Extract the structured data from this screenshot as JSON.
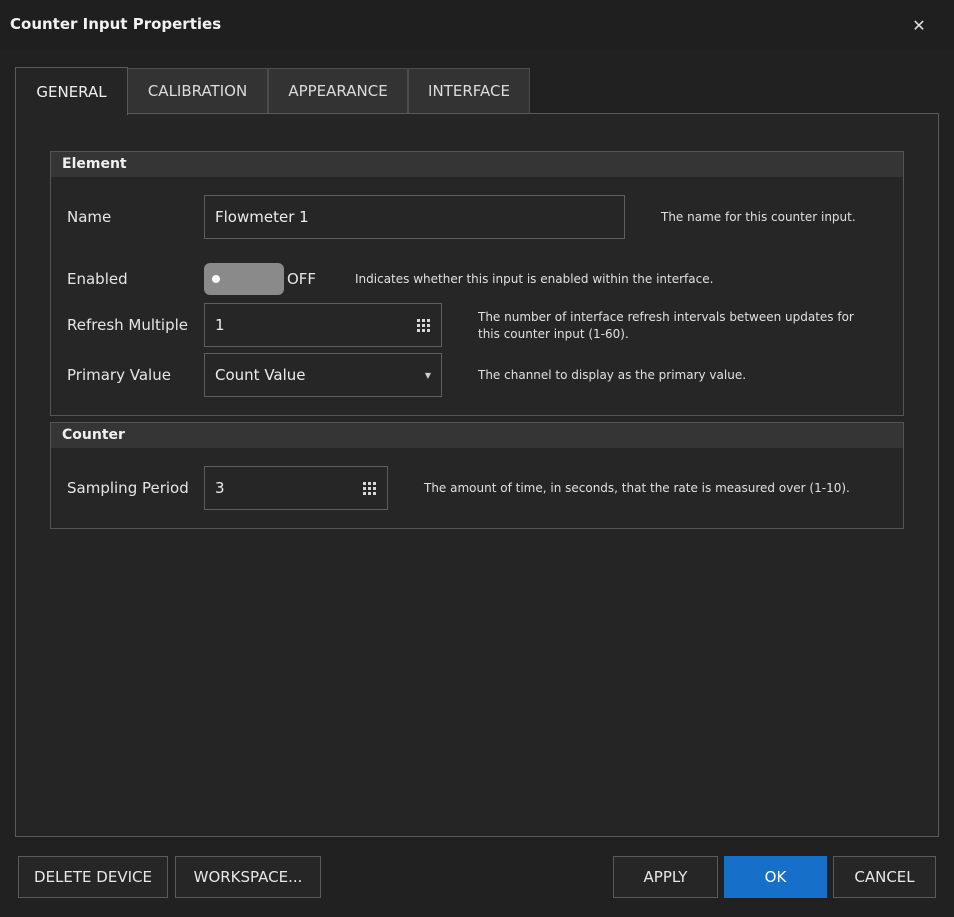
{
  "window": {
    "title": "Counter Input Properties",
    "close_glyph": "✕"
  },
  "tabs": [
    {
      "label": "GENERAL",
      "active": true
    },
    {
      "label": "CALIBRATION",
      "active": false
    },
    {
      "label": "APPEARANCE",
      "active": false
    },
    {
      "label": "INTERFACE",
      "active": false
    }
  ],
  "element_group": {
    "title": "Element",
    "name": {
      "label": "Name",
      "value": "Flowmeter 1",
      "description": "The name for this counter input."
    },
    "enabled": {
      "label": "Enabled",
      "state": "OFF",
      "description": "Indicates whether this input is enabled within the interface."
    },
    "refresh_multiple": {
      "label": "Refresh Multiple",
      "value": "1",
      "description": "The number of interface refresh intervals between updates for this counter input (1-60)."
    },
    "primary_value": {
      "label": "Primary Value",
      "value": "Count Value",
      "description": "The channel to display as the primary value."
    }
  },
  "counter_group": {
    "title": "Counter",
    "sampling_period": {
      "label": "Sampling Period",
      "value": "3",
      "description": "The amount of time, in seconds, that the rate is measured over (1-10)."
    }
  },
  "footer": {
    "delete_device": "DELETE DEVICE",
    "workspace": "WORKSPACE...",
    "apply": "APPLY",
    "ok": "OK",
    "cancel": "CANCEL"
  },
  "icons": {
    "keypad": "keypad-icon",
    "dropdown": "chevron-down-icon",
    "close": "close-icon"
  },
  "colors": {
    "accent": "#1670c9",
    "background": "#212121",
    "toggle_off": "#8a8a8a"
  }
}
